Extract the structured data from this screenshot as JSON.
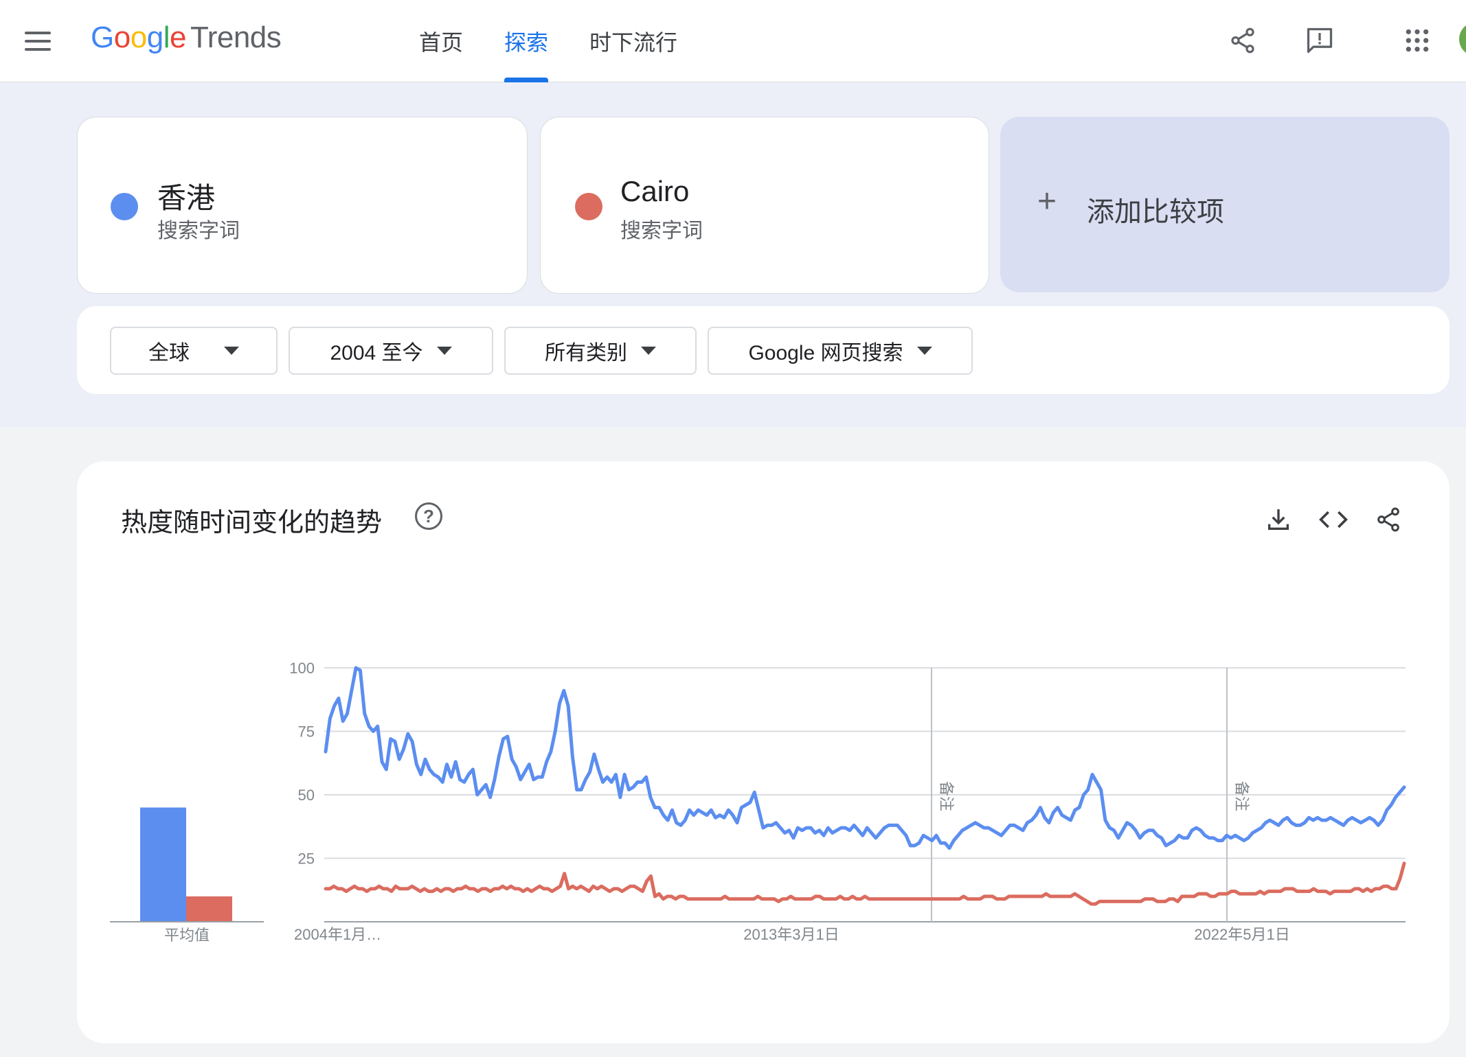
{
  "header": {
    "logo_google": "Google",
    "logo_trends": "Trends",
    "nav": [
      "首页",
      "探索",
      "时下流行"
    ],
    "active_nav": "探索",
    "icons": [
      "share-icon",
      "feedback-icon",
      "apps-icon"
    ]
  },
  "terms": [
    {
      "name": "香港",
      "type": "搜索字词",
      "color": "#5c8ef0"
    },
    {
      "name": "Cairo",
      "type": "搜索字词",
      "color": "#db6c5f"
    }
  ],
  "add_compare": {
    "plus": "+",
    "label": "添加比较项"
  },
  "filters": [
    {
      "label": "全球"
    },
    {
      "label": "2004 至今"
    },
    {
      "label": "所有类别"
    },
    {
      "label": "Google 网页搜索"
    }
  ],
  "chart_section": {
    "title": "热度随时间变化的趋势",
    "help": "?",
    "icons": [
      "download-icon",
      "embed-code-icon",
      "share-icon"
    ],
    "avg_label": "平均值"
  },
  "chart_data": [
    {
      "type": "bar",
      "categories": [
        "香港",
        "Cairo"
      ],
      "values": [
        45,
        10
      ],
      "xlabel": "平均值",
      "ylim": [
        0,
        100
      ],
      "colors": [
        "#5c8ef0",
        "#db6c5f"
      ]
    },
    {
      "type": "line",
      "yticks": [
        25,
        50,
        75,
        100
      ],
      "ylim": [
        0,
        100
      ],
      "x_start": "2004年1月…",
      "x_tick_labels": [
        "2004年1月…",
        "2013年3月1日",
        "2022年5月1日"
      ],
      "annotations": [
        "备注",
        "备注"
      ],
      "grid": true,
      "series": [
        {
          "name": "香港",
          "color": "#5c8ef0",
          "values": [
            67,
            80,
            85,
            88,
            79,
            82,
            91,
            100,
            99,
            82,
            77,
            75,
            77,
            63,
            60,
            72,
            71,
            64,
            68,
            74,
            71,
            62,
            58,
            64,
            60,
            58,
            57,
            55,
            62,
            57,
            63,
            56,
            55,
            58,
            60,
            50,
            52,
            54,
            49,
            56,
            65,
            72,
            73,
            64,
            61,
            56,
            59,
            62,
            56,
            57,
            57,
            63,
            67,
            75,
            86,
            91,
            85,
            65,
            52,
            52,
            56,
            59,
            66,
            60,
            55,
            57,
            55,
            58,
            49,
            58,
            52,
            53,
            55,
            55,
            57,
            49,
            45,
            45,
            42,
            40,
            44,
            39,
            38,
            40,
            44,
            42,
            44,
            43,
            42,
            44,
            41,
            42,
            41,
            44,
            42,
            39,
            45,
            46,
            47,
            51,
            44,
            37,
            38,
            38,
            39,
            37,
            35,
            36,
            33,
            37,
            36,
            37,
            37,
            35,
            36,
            34,
            37,
            35,
            36,
            37,
            37,
            36,
            38,
            36,
            34,
            37,
            35,
            33,
            35,
            37,
            38,
            38,
            38,
            36,
            34,
            30,
            30,
            31,
            34,
            33,
            32,
            34,
            31,
            31,
            29,
            32,
            34,
            36,
            37,
            38,
            39,
            38,
            37,
            37,
            36,
            35,
            34,
            36,
            38,
            38,
            37,
            36,
            39,
            40,
            42,
            45,
            41,
            39,
            43,
            45,
            42,
            41,
            40,
            44,
            45,
            50,
            52,
            58,
            55,
            52,
            40,
            37,
            36,
            33,
            36,
            39,
            38,
            36,
            33,
            35,
            36,
            36,
            34,
            33,
            30,
            31,
            32,
            34,
            33,
            33,
            36,
            37,
            36,
            34,
            33,
            33,
            32,
            32,
            34,
            33,
            34,
            33,
            32,
            33,
            35,
            36,
            37,
            39,
            40,
            39,
            38,
            40,
            41,
            39,
            38,
            38,
            39,
            41,
            40,
            41,
            40,
            40,
            41,
            40,
            39,
            38,
            40,
            41,
            40,
            39,
            40,
            41,
            40,
            38,
            40,
            44,
            46,
            49,
            51,
            53
          ]
        },
        {
          "name": "Cairo",
          "color": "#db6c5f",
          "values": [
            13,
            13,
            14,
            13,
            13,
            12,
            13,
            14,
            13,
            13,
            12,
            13,
            13,
            14,
            13,
            13,
            12,
            14,
            13,
            13,
            13,
            14,
            13,
            12,
            13,
            12,
            12,
            13,
            12,
            13,
            13,
            12,
            13,
            13,
            14,
            13,
            13,
            12,
            13,
            13,
            12,
            13,
            13,
            14,
            13,
            14,
            13,
            13,
            12,
            13,
            12,
            13,
            14,
            13,
            13,
            12,
            13,
            14,
            19,
            13,
            14,
            13,
            14,
            13,
            12,
            14,
            13,
            14,
            13,
            12,
            13,
            13,
            12,
            13,
            14,
            14,
            13,
            12,
            16,
            18,
            10,
            11,
            9,
            10,
            10,
            9,
            10,
            10,
            9,
            9,
            9,
            9,
            9,
            9,
            9,
            9,
            9,
            10,
            9,
            9,
            9,
            9,
            9,
            9,
            9,
            10,
            9,
            9,
            9,
            9,
            8,
            9,
            9,
            10,
            9,
            9,
            9,
            9,
            9,
            10,
            10,
            9,
            9,
            9,
            9,
            10,
            9,
            9,
            10,
            9,
            9,
            10,
            9,
            9,
            9,
            9,
            9,
            9,
            9,
            9,
            9,
            9,
            9,
            9,
            9,
            9,
            9,
            9,
            9,
            9,
            9,
            9,
            9,
            9,
            9,
            10,
            9,
            9,
            9,
            9,
            10,
            10,
            10,
            9,
            9,
            9,
            10,
            10,
            10,
            10,
            10,
            10,
            10,
            10,
            10,
            11,
            10,
            10,
            10,
            10,
            10,
            10,
            11,
            10,
            9,
            8,
            7,
            7,
            8,
            8,
            8,
            8,
            8,
            8,
            8,
            8,
            8,
            8,
            8,
            9,
            9,
            9,
            8,
            8,
            8,
            9,
            9,
            8,
            10,
            10,
            10,
            10,
            11,
            11,
            11,
            10,
            10,
            11,
            11,
            11,
            12,
            12,
            11,
            11,
            11,
            11,
            11,
            12,
            11,
            12,
            12,
            12,
            12,
            13,
            13,
            13,
            12,
            12,
            12,
            12,
            13,
            12,
            12,
            12,
            11,
            12,
            12,
            12,
            12,
            12,
            13,
            13,
            12,
            13,
            12,
            13,
            13,
            14,
            14,
            13,
            13,
            17,
            23
          ]
        }
      ]
    }
  ]
}
